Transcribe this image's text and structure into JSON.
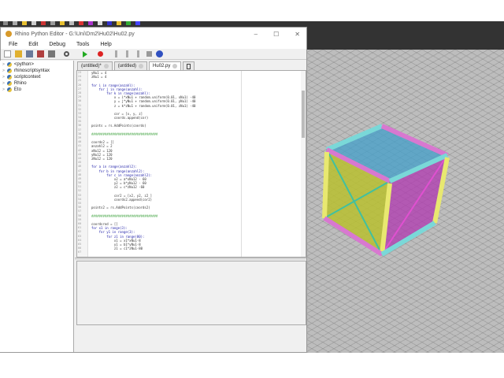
{
  "window": {
    "title": "Rhino Python Editor - G:\\Uni\\Dm2\\Hu02\\Hu02.py",
    "controls": [
      "–",
      "☐",
      "✕"
    ]
  },
  "menu": [
    "File",
    "Edit",
    "Debug",
    "Tools",
    "Help"
  ],
  "toolbar": [
    "new-file",
    "open-folder",
    "save",
    "save-as",
    "save-all",
    "find",
    "run",
    "stop",
    "step-into",
    "step-over",
    "step-out",
    "break",
    "help"
  ],
  "tree": [
    "<python>",
    "rhinoscriptsyntax",
    "scriptcontext",
    "Rhino",
    "Eto"
  ],
  "tabs": [
    {
      "label": "(untitled)*"
    },
    {
      "label": "(untitled)"
    },
    {
      "label": "Hu02.py"
    }
  ],
  "code": [
    {
      "n": "23",
      "t": "yNu1 = 4"
    },
    {
      "n": "24",
      "t": "zNu1 = 4"
    },
    {
      "n": "25",
      "t": ""
    },
    {
      "n": "26",
      "t": "for i in range(anzahl):",
      "k": 1
    },
    {
      "n": "27",
      "t": "    for j in range(anzahl):",
      "k": 1
    },
    {
      "n": "28",
      "t": "        for k in range(anzahl):",
      "k": 1
    },
    {
      "n": "29",
      "t": "            x = i*xNu1 + random.uniform(0.01, xNu1) -40"
    },
    {
      "n": "30",
      "t": "            y = j*yNu1 + random.uniform(0.01, yNu1) -40"
    },
    {
      "n": "31",
      "t": "            z = k*zNu1 + random.uniform(0.01, zNu1) -40"
    },
    {
      "n": "32",
      "t": ""
    },
    {
      "n": "33",
      "t": "            cor = [x, y, z]"
    },
    {
      "n": "34",
      "t": "            coords.append(cor)"
    },
    {
      "n": "35",
      "t": ""
    },
    {
      "n": "36",
      "t": "points = rs.AddPoints(coords)"
    },
    {
      "n": "37",
      "t": ""
    },
    {
      "n": "38",
      "t": "###################################",
      "h": 1
    },
    {
      "n": "39",
      "t": ""
    },
    {
      "n": "40",
      "t": "coords2 = []"
    },
    {
      "n": "41",
      "t": "anzahl2 = 2"
    },
    {
      "n": "42",
      "t": "xNu12 = 120"
    },
    {
      "n": "43",
      "t": "yNu12 = 120"
    },
    {
      "n": "44",
      "t": "zNu12 = 120"
    },
    {
      "n": "45",
      "t": ""
    },
    {
      "n": "46",
      "t": "for a in range(anzahl2):",
      "k": 1
    },
    {
      "n": "47",
      "t": "    for b in range(anzahl2):",
      "k": 1
    },
    {
      "n": "48",
      "t": "        for c in range(anzahl2):",
      "k": 1
    },
    {
      "n": "49",
      "t": "            x2 = a*xNu12 - 60"
    },
    {
      "n": "50",
      "t": "            y2 = b*yNu12 - 60"
    },
    {
      "n": "51",
      "t": "            z2 = c*zNu12 -60"
    },
    {
      "n": "52",
      "t": ""
    },
    {
      "n": "53",
      "t": "            cor2 = [x2, y2, z2 ]"
    },
    {
      "n": "54",
      "t": "            coords2.append(cor2)"
    },
    {
      "n": "55",
      "t": ""
    },
    {
      "n": "56",
      "t": "points2 = rs.AddPoints(coords2)"
    },
    {
      "n": "57",
      "t": ""
    },
    {
      "n": "58",
      "t": "###################################",
      "h": 1
    },
    {
      "n": "59",
      "t": ""
    },
    {
      "n": "60",
      "t": "coordsrod = []"
    },
    {
      "n": "61",
      "t": "for x1 in range(3):",
      "k": 1
    },
    {
      "n": "62",
      "t": "    for y1 in range(3):",
      "k": 1
    },
    {
      "n": "63",
      "t": "        for z1 in range(80):",
      "k": 1
    },
    {
      "n": "64",
      "t": "            x1 = x1*xNu1-8"
    },
    {
      "n": "65",
      "t": "            y1 = b1*yNu1-8"
    },
    {
      "n": "66",
      "t": "            z1 = c1*zNu1-80"
    },
    {
      "n": "67",
      "t": ""
    }
  ],
  "colors": {
    "yellow": "#e6e62e",
    "magenta": "#d85ad0",
    "cyan": "#66d8d8"
  }
}
